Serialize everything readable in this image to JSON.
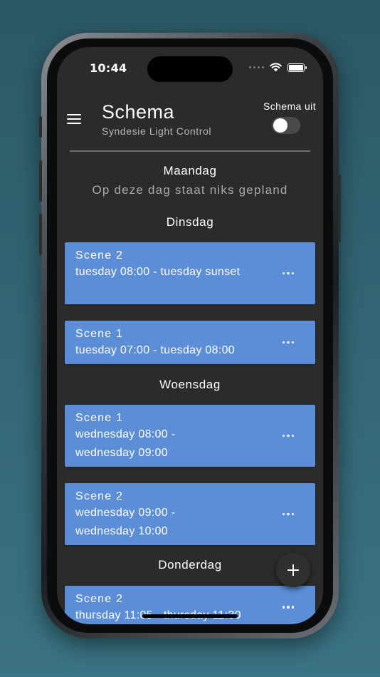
{
  "status_bar": {
    "time": "10:44"
  },
  "header": {
    "title": "Schema",
    "subtitle": "Syndesie Light Control",
    "toggle_label": "Schema uit",
    "toggle_on": false
  },
  "days": [
    {
      "name": "Maandag",
      "empty_text": "Op deze dag staat niks gepland",
      "items": []
    },
    {
      "name": "Dinsdag",
      "items": [
        {
          "scene": "Scene  2",
          "range": "tuesday 08:00 - tuesday sunset"
        },
        {
          "scene": "Scene  1",
          "range": "tuesday 07:00 - tuesday 08:00"
        }
      ]
    },
    {
      "name": "Woensdag",
      "items": [
        {
          "scene": "Scene  1",
          "range": "wednesday 08:00 - wednesday 09:00"
        },
        {
          "scene": "Scene  2",
          "range": "wednesday 09:00 - wednesday 10:00"
        }
      ]
    },
    {
      "name": "Donderdag",
      "items": [
        {
          "scene": "Scene  2",
          "range": "thursday 11:05 - thursday 11:30"
        }
      ]
    }
  ],
  "colors": {
    "card": "#5b8ed6",
    "background": "#2b2b2b",
    "frame_bg": "#2c5866"
  },
  "icons": {
    "menu": "hamburger-icon",
    "more": "more-horizontal-icon",
    "add": "plus-icon"
  }
}
